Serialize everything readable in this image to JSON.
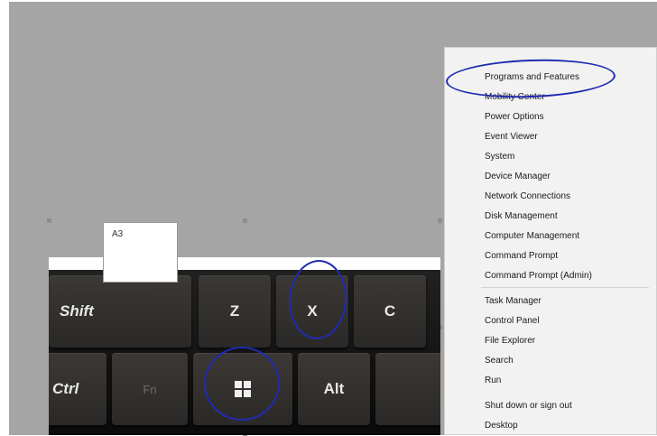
{
  "label_box": {
    "text": "A3"
  },
  "keyboard": {
    "row1": [
      "Shift",
      "Z",
      "X",
      "C"
    ],
    "row2": [
      "Ctrl",
      "Fn",
      "",
      "Alt"
    ]
  },
  "context_menu": {
    "items": [
      "Programs and Features",
      "Mobility Center",
      "Power Options",
      "Event Viewer",
      "System",
      "Device Manager",
      "Network Connections",
      "Disk Management",
      "Computer Management",
      "Command Prompt",
      "Command Prompt (Admin)",
      "Task Manager",
      "Control Panel",
      "File Explorer",
      "Search",
      "Run",
      "Shut down or sign out",
      "Desktop"
    ],
    "submenu_arrow": "▸"
  },
  "colors": {
    "ink": "#1f2bb0",
    "canvas": "#a5a5a5"
  }
}
